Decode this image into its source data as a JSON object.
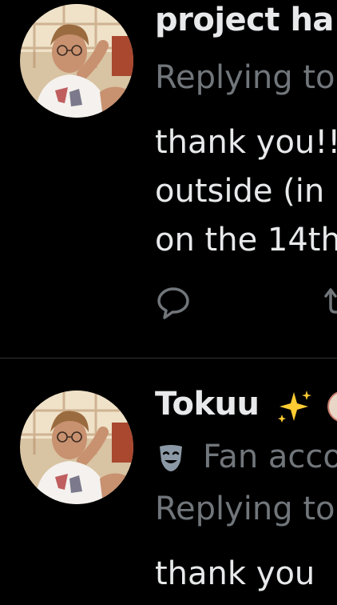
{
  "tweets": [
    {
      "author": "project ha",
      "replying": "Replying to",
      "text_lines": [
        "thank you!!",
        "outside (in",
        "on the 14th"
      ]
    },
    {
      "author": "Tokuu",
      "name_emoji": "✨",
      "account_label": "Fan acco",
      "replying": "Replying to",
      "text_lines": [
        "thank you"
      ]
    }
  ],
  "colors": {
    "background": "#000000",
    "primary_text": "#e7e9ea",
    "secondary_text": "#71767b",
    "divider": "#2f3336",
    "sparkle": "#ffcc33"
  },
  "icons": {
    "reply": "reply-bubble-icon",
    "retweet": "retweet-icon",
    "account_badge": "theater-masks-icon"
  }
}
